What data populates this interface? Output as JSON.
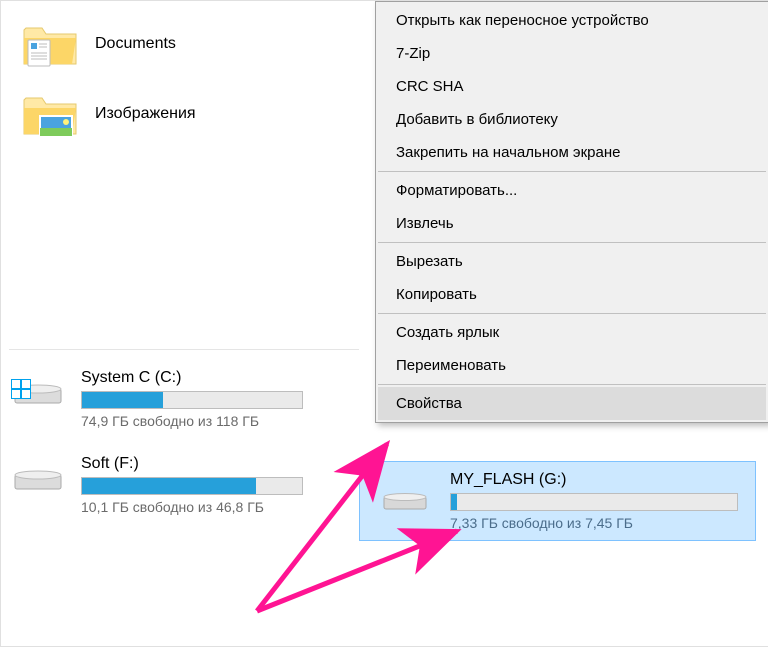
{
  "sidebar": {
    "folders": [
      {
        "label": "Documents",
        "icon": "folder-documents-icon"
      },
      {
        "label": "Изображения",
        "icon": "folder-pictures-icon"
      }
    ]
  },
  "drives": {
    "system": {
      "title": "System C (C:)",
      "free_text": "74,9 ГБ свободно из 118 ГБ",
      "fill_pct": 37
    },
    "soft": {
      "title": "Soft (F:)",
      "free_text": "10,1 ГБ свободно из 46,8 ГБ",
      "fill_pct": 79
    },
    "flash": {
      "title": "MY_FLASH (G:)",
      "free_text": "7,33 ГБ свободно из 7,45 ГБ",
      "fill_pct": 2
    }
  },
  "context_menu": {
    "groups": [
      [
        "Открыть как переносное устройство",
        "7-Zip",
        "CRC SHA",
        "Добавить в библиотеку",
        "Закрепить на начальном экране"
      ],
      [
        "Форматировать...",
        "Извлечь"
      ],
      [
        "Вырезать",
        "Копировать"
      ],
      [
        "Создать ярлык",
        "Переименовать"
      ],
      [
        "Свойства"
      ]
    ],
    "highlight": "Свойства"
  },
  "annotation": {
    "color": "#ff1493"
  }
}
